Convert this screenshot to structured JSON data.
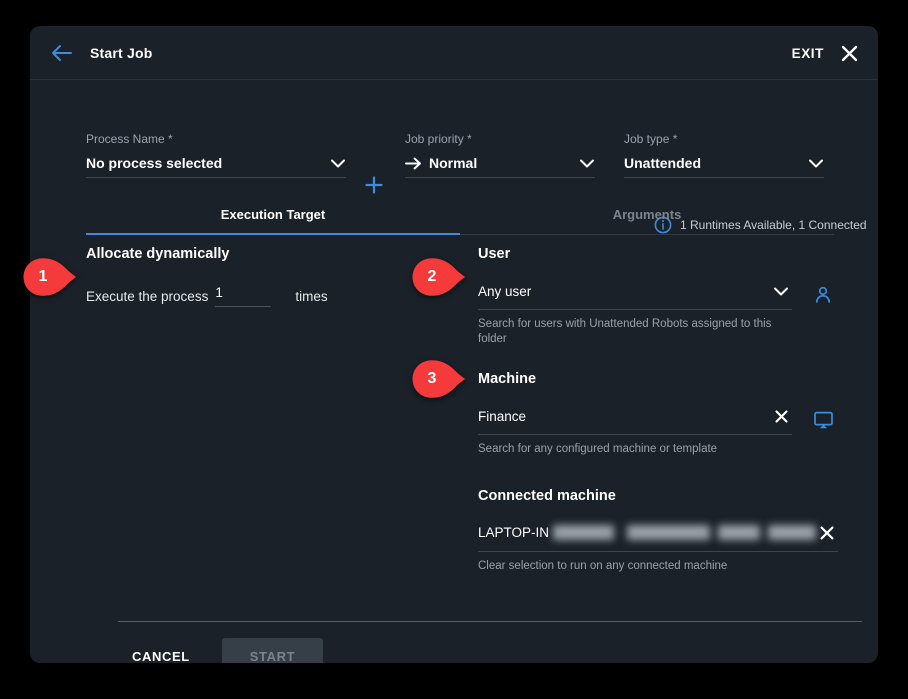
{
  "header": {
    "title": "Start Job",
    "back_icon": "arrow-left-icon",
    "exit_label": "EXIT",
    "close_icon": "close-icon"
  },
  "fields": {
    "process": {
      "label": "Process Name *",
      "value": "No process selected",
      "caret_icon": "chevron-down-icon",
      "add_icon": "plus-icon"
    },
    "priority": {
      "label": "Job priority *",
      "value": "Normal",
      "prefix_icon": "arrow-right-icon",
      "caret_icon": "chevron-down-icon"
    },
    "job_type": {
      "label": "Job type *",
      "value": "Unattended",
      "caret_icon": "chevron-down-icon"
    }
  },
  "runtimes": {
    "icon": "info-icon",
    "text": "1 Runtimes Available, 1 Connected"
  },
  "tabs": [
    {
      "label": "Execution Target",
      "active": true
    },
    {
      "label": "Arguments",
      "active": false
    }
  ],
  "left": {
    "title": "Allocate dynamically",
    "execute_prefix": "Execute the process",
    "times_value": "1",
    "times_suffix": "times"
  },
  "right": {
    "user": {
      "title": "User",
      "value": "Any user",
      "caret_icon": "chevron-down-icon",
      "side_icon": "person-icon",
      "hint": "Search for users with Unattended Robots assigned to this folder"
    },
    "machine": {
      "title": "Machine",
      "value": "Finance",
      "clear_icon": "close-icon",
      "side_icon": "monitor-icon",
      "hint": "Search for any configured machine or template"
    },
    "connected_machine": {
      "title": "Connected machine",
      "value": "LAPTOP-IN",
      "redacted": true,
      "clear_icon": "close-icon",
      "hint": "Clear selection to run on any connected machine"
    }
  },
  "footer": {
    "cancel_label": "CANCEL",
    "start_label": "START",
    "start_disabled": true
  },
  "callouts": [
    {
      "number": "1"
    },
    {
      "number": "2"
    },
    {
      "number": "3"
    }
  ],
  "colors": {
    "accent_blue": "#3c8ddc",
    "callout_red": "#f43a3a",
    "panel_bg": "#1b2129",
    "page_bg": "#000000"
  }
}
